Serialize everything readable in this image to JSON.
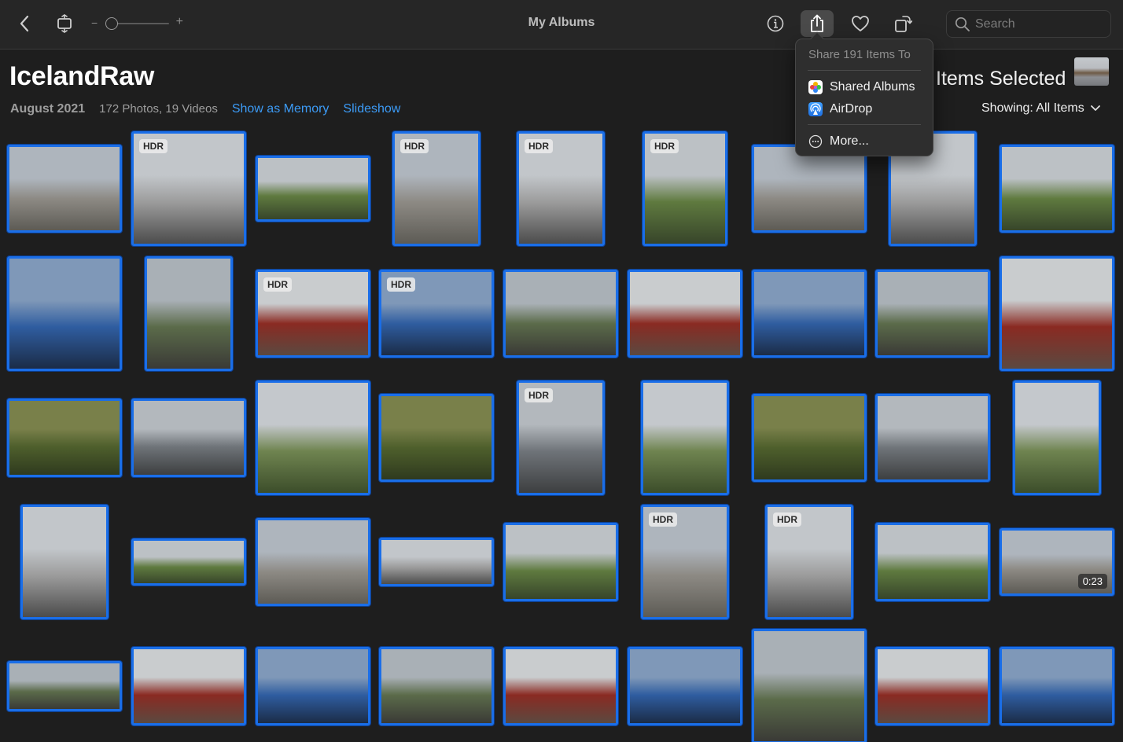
{
  "toolbar": {
    "title": "My Albums",
    "zoom_minus": "−",
    "zoom_plus": "+",
    "search_placeholder": "Search",
    "icons": [
      "back-icon",
      "fit-icon",
      "info-icon",
      "share-icon",
      "heart-icon",
      "rotate-icon",
      "search-icon"
    ]
  },
  "album": {
    "title": "IcelandRaw",
    "date": "August 2021",
    "counts": "172 Photos, 19 Videos",
    "show_as_memory": "Show as Memory",
    "slideshow": "Slideshow",
    "selected_label": "Items Selected",
    "showing": "Showing: All Items"
  },
  "share_menu": {
    "header": "Share 191 Items To",
    "items": [
      {
        "label": "Shared Albums",
        "icon": "shared-albums-icon"
      },
      {
        "label": "AirDrop",
        "icon": "airdrop-icon"
      },
      {
        "label": "More...",
        "icon": "more-icon"
      }
    ]
  },
  "photos": [
    [
      {
        "label": "",
        "duration": ""
      },
      {
        "label": "HDR",
        "duration": ""
      },
      {
        "label": "",
        "duration": ""
      },
      {
        "label": "HDR",
        "duration": ""
      },
      {
        "label": "HDR",
        "duration": ""
      },
      {
        "label": "HDR",
        "duration": ""
      },
      {
        "label": "",
        "duration": ""
      },
      {
        "label": "",
        "duration": ""
      },
      {
        "label": "",
        "duration": ""
      }
    ],
    [
      {
        "label": "",
        "duration": ""
      },
      {
        "label": "",
        "duration": ""
      },
      {
        "label": "HDR",
        "duration": ""
      },
      {
        "label": "HDR",
        "duration": ""
      },
      {
        "label": "",
        "duration": ""
      },
      {
        "label": "",
        "duration": ""
      },
      {
        "label": "",
        "duration": ""
      },
      {
        "label": "",
        "duration": ""
      },
      {
        "label": "",
        "duration": ""
      }
    ],
    [
      {
        "label": "",
        "duration": ""
      },
      {
        "label": "",
        "duration": ""
      },
      {
        "label": "",
        "duration": ""
      },
      {
        "label": "",
        "duration": ""
      },
      {
        "label": "HDR",
        "duration": ""
      },
      {
        "label": "",
        "duration": ""
      },
      {
        "label": "",
        "duration": ""
      },
      {
        "label": "",
        "duration": ""
      },
      {
        "label": "",
        "duration": ""
      }
    ],
    [
      {
        "label": "",
        "duration": ""
      },
      {
        "label": "",
        "duration": ""
      },
      {
        "label": "",
        "duration": ""
      },
      {
        "label": "",
        "duration": ""
      },
      {
        "label": "",
        "duration": ""
      },
      {
        "label": "HDR",
        "duration": ""
      },
      {
        "label": "HDR",
        "duration": ""
      },
      {
        "label": "",
        "duration": ""
      },
      {
        "label": "",
        "duration": "0:23"
      }
    ],
    [
      {
        "label": "",
        "duration": ""
      },
      {
        "label": "",
        "duration": ""
      },
      {
        "label": "",
        "duration": ""
      },
      {
        "label": "",
        "duration": ""
      },
      {
        "label": "",
        "duration": ""
      },
      {
        "label": "",
        "duration": ""
      },
      {
        "label": "",
        "duration": ""
      },
      {
        "label": "",
        "duration": ""
      },
      {
        "label": "",
        "duration": ""
      }
    ]
  ],
  "colors": {
    "selection_border": "#1a6ee8",
    "link": "#3c9bf6",
    "background": "#1e1e1e"
  }
}
